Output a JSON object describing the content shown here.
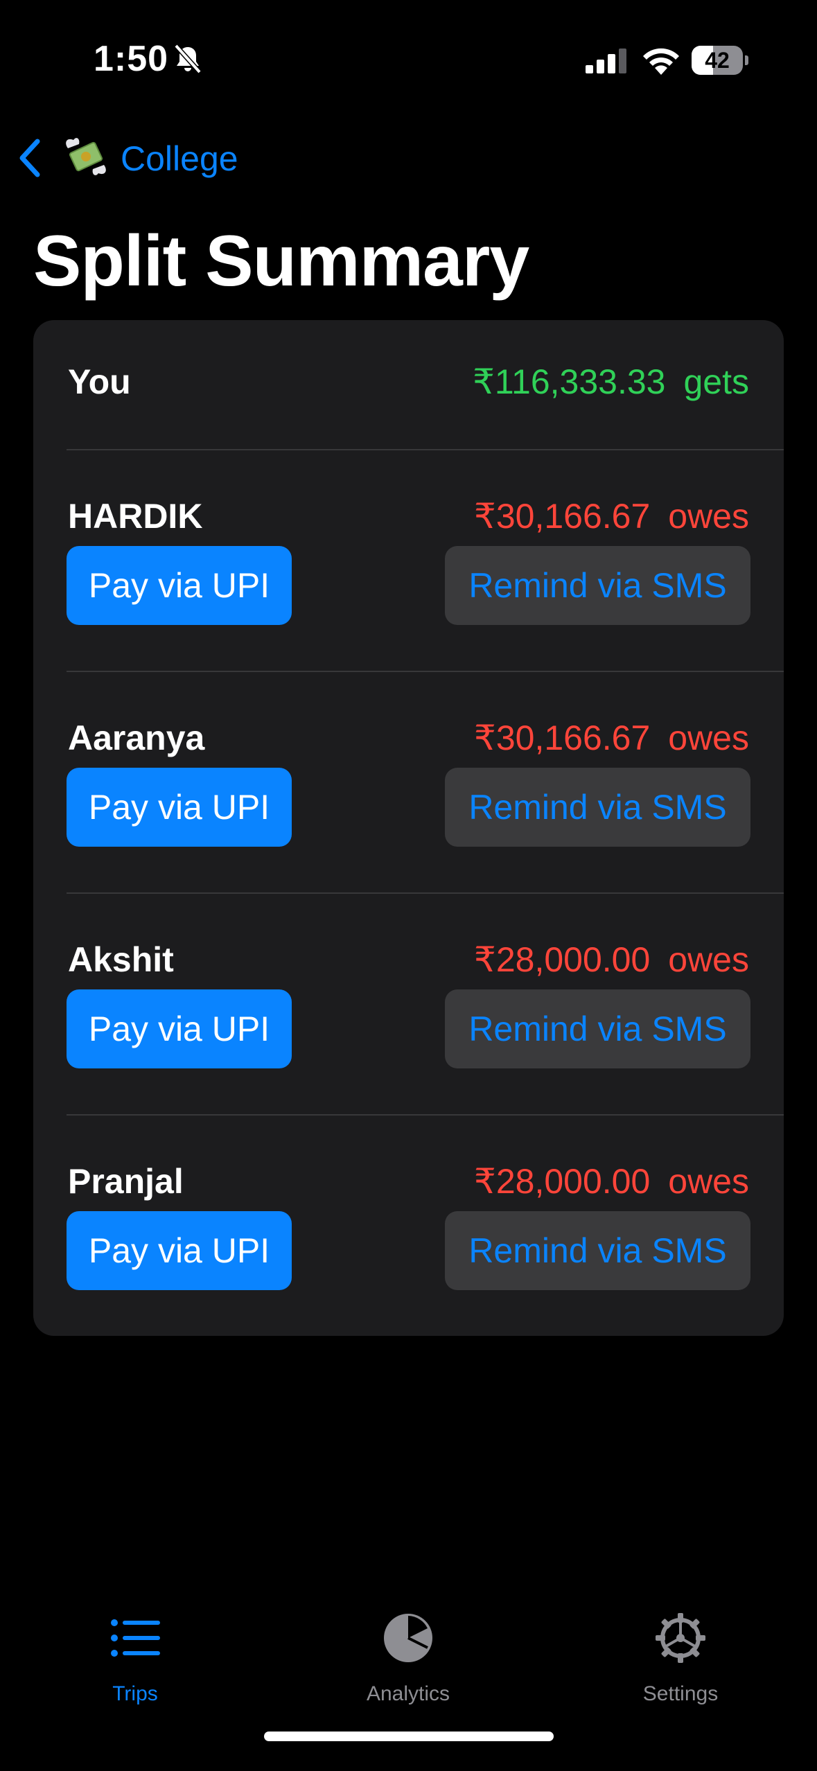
{
  "status_bar": {
    "time": "1:50",
    "battery": "42",
    "battery_level": 0.42
  },
  "nav": {
    "back_label": "College",
    "trip_icon": "money-with-wings-emoji"
  },
  "page": {
    "title": "Split Summary"
  },
  "summary": {
    "you": {
      "name": "You",
      "amount": "₹116,333.33",
      "status": "gets"
    },
    "members": [
      {
        "name": "HARDIK",
        "amount": "₹30,166.67",
        "status": "owes",
        "pay_label": "Pay via UPI",
        "remind_label": "Remind via SMS"
      },
      {
        "name": "Aaranya",
        "amount": "₹30,166.67",
        "status": "owes",
        "pay_label": "Pay via UPI",
        "remind_label": "Remind via SMS"
      },
      {
        "name": "Akshit",
        "amount": "₹28,000.00",
        "status": "owes",
        "pay_label": "Pay via UPI",
        "remind_label": "Remind via SMS"
      },
      {
        "name": "Pranjal",
        "amount": "₹28,000.00",
        "status": "owes",
        "pay_label": "Pay via UPI",
        "remind_label": "Remind via SMS"
      }
    ]
  },
  "tab_bar": {
    "tabs": [
      {
        "label": "Trips",
        "icon": "list-icon",
        "active": true
      },
      {
        "label": "Analytics",
        "icon": "pie-chart-icon",
        "active": false
      },
      {
        "label": "Settings",
        "icon": "gear-icon",
        "active": false
      }
    ]
  },
  "colors": {
    "accent": "#0a84ff",
    "positive": "#30d158",
    "negative": "#ff453a",
    "card": "#1c1c1e",
    "inactive_tab": "#8e8e93"
  }
}
